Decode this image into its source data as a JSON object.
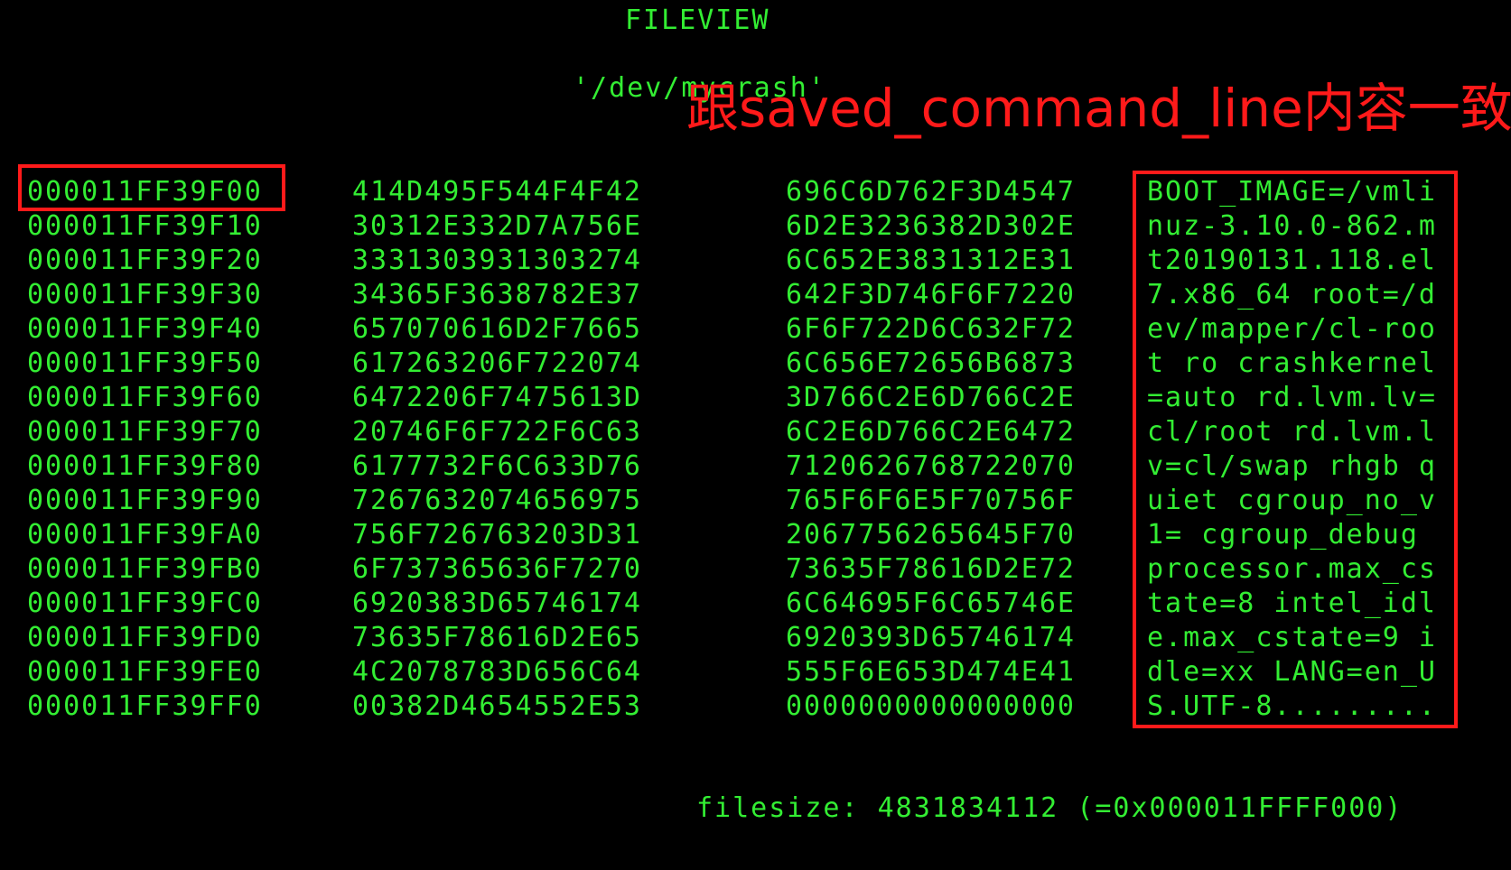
{
  "header": {
    "title": "FILEVIEW",
    "path": "'/dev/mycrash'"
  },
  "annotation": {
    "note": "跟saved_command_line内容一致",
    "color": "#ff1a1a"
  },
  "dump": {
    "rows": [
      {
        "address": "000011FF39F00",
        "hex1": "414D495F544F4F42",
        "hex2": "696C6D762F3D4547",
        "ascii": "BOOT_IMAGE=/vmli"
      },
      {
        "address": "000011FF39F10",
        "hex1": "30312E332D7A756E",
        "hex2": "6D2E3236382D302E",
        "ascii": "nuz-3.10.0-862.m"
      },
      {
        "address": "000011FF39F20",
        "hex1": "3331303931303274",
        "hex2": "6C652E3831312E31",
        "ascii": "t20190131.118.el"
      },
      {
        "address": "000011FF39F30",
        "hex1": "34365F3638782E37",
        "hex2": "642F3D746F6F7220",
        "ascii": "7.x86_64 root=/d"
      },
      {
        "address": "000011FF39F40",
        "hex1": "657070616D2F7665",
        "hex2": "6F6F722D6C632F72",
        "ascii": "ev/mapper/cl-roo"
      },
      {
        "address": "000011FF39F50",
        "hex1": "617263206F722074",
        "hex2": "6C656E72656B6873",
        "ascii": "t ro crashkernel"
      },
      {
        "address": "000011FF39F60",
        "hex1": "6472206F7475613D",
        "hex2": "3D766C2E6D766C2E",
        "ascii": "=auto rd.lvm.lv="
      },
      {
        "address": "000011FF39F70",
        "hex1": "20746F6F722F6C63",
        "hex2": "6C2E6D766C2E6472",
        "ascii": "cl/root rd.lvm.l"
      },
      {
        "address": "000011FF39F80",
        "hex1": "6177732F6C633D76",
        "hex2": "7120626768722070",
        "ascii": "v=cl/swap rhgb q"
      },
      {
        "address": "000011FF39F90",
        "hex1": "7267632074656975",
        "hex2": "765F6F6E5F70756F",
        "ascii": "uiet cgroup_no_v"
      },
      {
        "address": "000011FF39FA0",
        "hex1": "756F726763203D31",
        "hex2": "2067756265645F70",
        "ascii": "1= cgroup_debug "
      },
      {
        "address": "000011FF39FB0",
        "hex1": "6F737365636F7270",
        "hex2": "73635F78616D2E72",
        "ascii": "processor.max_cs"
      },
      {
        "address": "000011FF39FC0",
        "hex1": "6920383D65746174",
        "hex2": "6C64695F6C65746E",
        "ascii": "tate=8 intel_idl"
      },
      {
        "address": "000011FF39FD0",
        "hex1": "73635F78616D2E65",
        "hex2": "6920393D65746174",
        "ascii": "e.max_cstate=9 i"
      },
      {
        "address": "000011FF39FE0",
        "hex1": "4C2078783D656C64",
        "hex2": "555F6E653D474E41",
        "ascii": "dle=xx LANG=en_U"
      },
      {
        "address": "000011FF39FF0",
        "hex1": "00382D4654552E53",
        "hex2": "0000000000000000",
        "ascii": "S.UTF-8........."
      }
    ]
  },
  "footer": {
    "filesize": "filesize: 4831834112 (=0x000011FFFF000)"
  },
  "colors": {
    "text": "#33ee33",
    "background": "#000000"
  }
}
